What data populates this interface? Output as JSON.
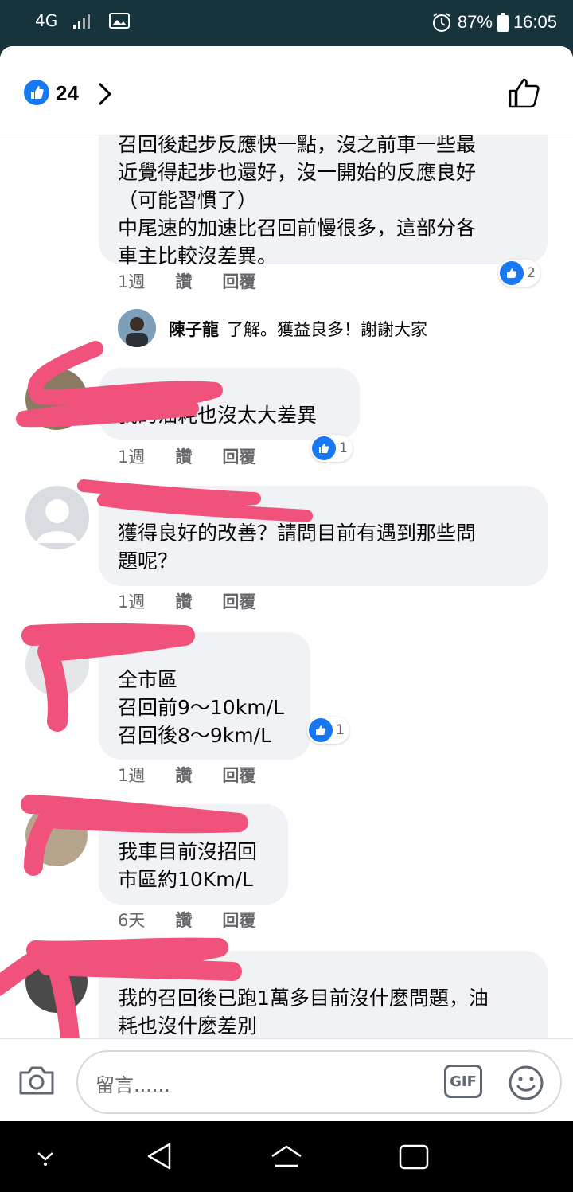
{
  "status_bar": {
    "network": "4G",
    "battery": "87%",
    "time": "16:05"
  },
  "header": {
    "like_count": "24"
  },
  "comments": [
    {
      "id": "c0",
      "text": "召回後起步反應快一點，沒之前車一些最\n近覺得起步也還好，沒一開始的反應良好\n（可能習慣了）\n中尾速的加速比召回前慢很多，這部分各\n車主比較沒差異。",
      "time": "1週",
      "like": "讚",
      "reply": "回覆",
      "reaction_count": "2"
    },
    {
      "id": "c1",
      "author": "陳子龍",
      "text": "了解。獲益良多！謝謝大家"
    },
    {
      "id": "c2",
      "text": "我的油耗也沒太大差異",
      "time": "1週",
      "like": "讚",
      "reply": "回覆",
      "reaction_count": "1"
    },
    {
      "id": "c3",
      "text": "獲得良好的改善？請問目前有遇到那些問\n題呢？",
      "time": "1週",
      "like": "讚",
      "reply": "回覆"
    },
    {
      "id": "c4",
      "text": "全市區\n召回前9～10km/L\n召回後8～9km/L",
      "time": "1週",
      "like": "讚",
      "reply": "回覆",
      "reaction_count": "1"
    },
    {
      "id": "c5",
      "text": "我車目前沒招回\n市區約10Km/L",
      "time": "6天",
      "like": "讚",
      "reply": "回覆"
    },
    {
      "id": "c6",
      "text": "我的召回後已跑1萬多目前沒什麼問題，油\n耗也沒什麼差別"
    }
  ],
  "composer": {
    "placeholder": "留言......",
    "gif_label": "GIF"
  },
  "colors": {
    "accent": "#1877f2",
    "bubble": "#f0f2f5",
    "redaction": "#f0527c"
  }
}
